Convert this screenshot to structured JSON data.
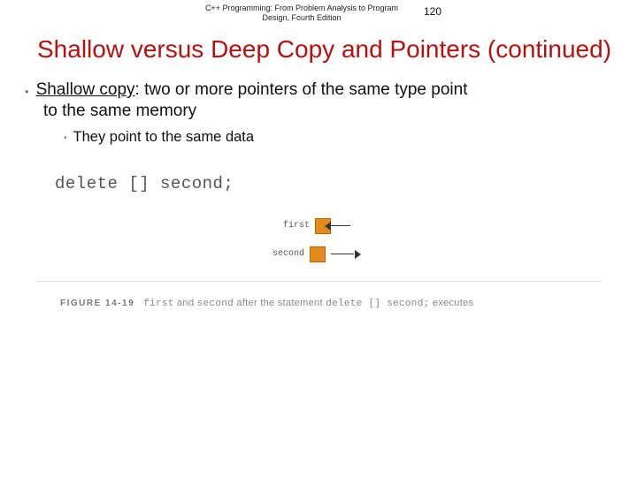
{
  "header": {
    "source": "C++ Programming: From Problem Analysis to Program Design, Fourth Edition",
    "page": "120"
  },
  "title": "Shallow versus Deep Copy and Pointers (continued)",
  "bullet": {
    "term": "Shallow copy",
    "rest": ": two or more pointers of the same type point",
    "cont": "to the same memory"
  },
  "subbullet": "They point to the same data",
  "code": "delete [] second;",
  "diagram": {
    "first_label": "first",
    "second_label": "second"
  },
  "caption": {
    "fig": "FIGURE 14-19",
    "pre": " ",
    "m1": "first",
    "mid1": " and ",
    "m2": "second",
    "mid2": " after the statement ",
    "m3": "delete [] second;",
    "post": " executes"
  }
}
